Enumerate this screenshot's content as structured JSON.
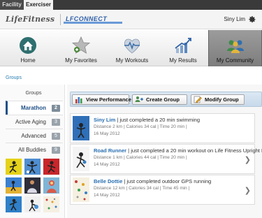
{
  "top_tabs": [
    "Facility",
    "Exerciser"
  ],
  "header": {
    "logo_text": "LifeFitness",
    "connect_text": "LFCONNECT",
    "user_name": "Siny Lim",
    "settings_icon": "gear-icon"
  },
  "nav": [
    {
      "label": "Home",
      "icon": "house-icon"
    },
    {
      "label": "My Favorites",
      "icon": "star-icon"
    },
    {
      "label": "My Workouts",
      "icon": "heart-pulse-icon"
    },
    {
      "label": "My Results",
      "icon": "chart-icon"
    },
    {
      "label": "My Community",
      "icon": "people-icon",
      "active": true
    }
  ],
  "breadcrumb": "Groups",
  "groups": {
    "heading": "Groups",
    "items": [
      {
        "name": "Marathon",
        "count": "2",
        "selected": true
      },
      {
        "name": "Active Aging",
        "count": "3"
      },
      {
        "name": "Advanced",
        "count": "5"
      },
      {
        "name": "All Buddies",
        "count": "9"
      }
    ]
  },
  "actions": [
    {
      "label": "View Performance",
      "icon": "bar-chart-icon"
    },
    {
      "label": "Create Group",
      "icon": "add-group-icon"
    },
    {
      "label": "Modify Group",
      "icon": "edit-icon"
    }
  ],
  "feed": [
    {
      "name": "Siny Lim",
      "message": " | just completed a 20 min swimming",
      "stats": "Distance 2 km  |  Calories  34 cal  |  Time 20 min  |",
      "date": "16 May 2012",
      "has_chevron": false
    },
    {
      "name": "Road Runner",
      "message": " | just completed a 20 min workout on Life Fitness Upright Bike",
      "stats": "Distance 1 km  |  Calories 44 cal  |  Time 20 min  |",
      "date": "14 May 2012",
      "has_chevron": true
    },
    {
      "name": "Belle Dottie",
      "message": " | just completed outdoor GPS running",
      "stats": "Distance 12 km  |  Calories  34 cal  |  Time 45 min  |",
      "date": "14 May 2012",
      "has_chevron": true
    }
  ],
  "colors": {
    "accent_blue": "#1e4f86",
    "link_blue": "#2a6fb0",
    "active_nav": "#8a8a8a"
  }
}
